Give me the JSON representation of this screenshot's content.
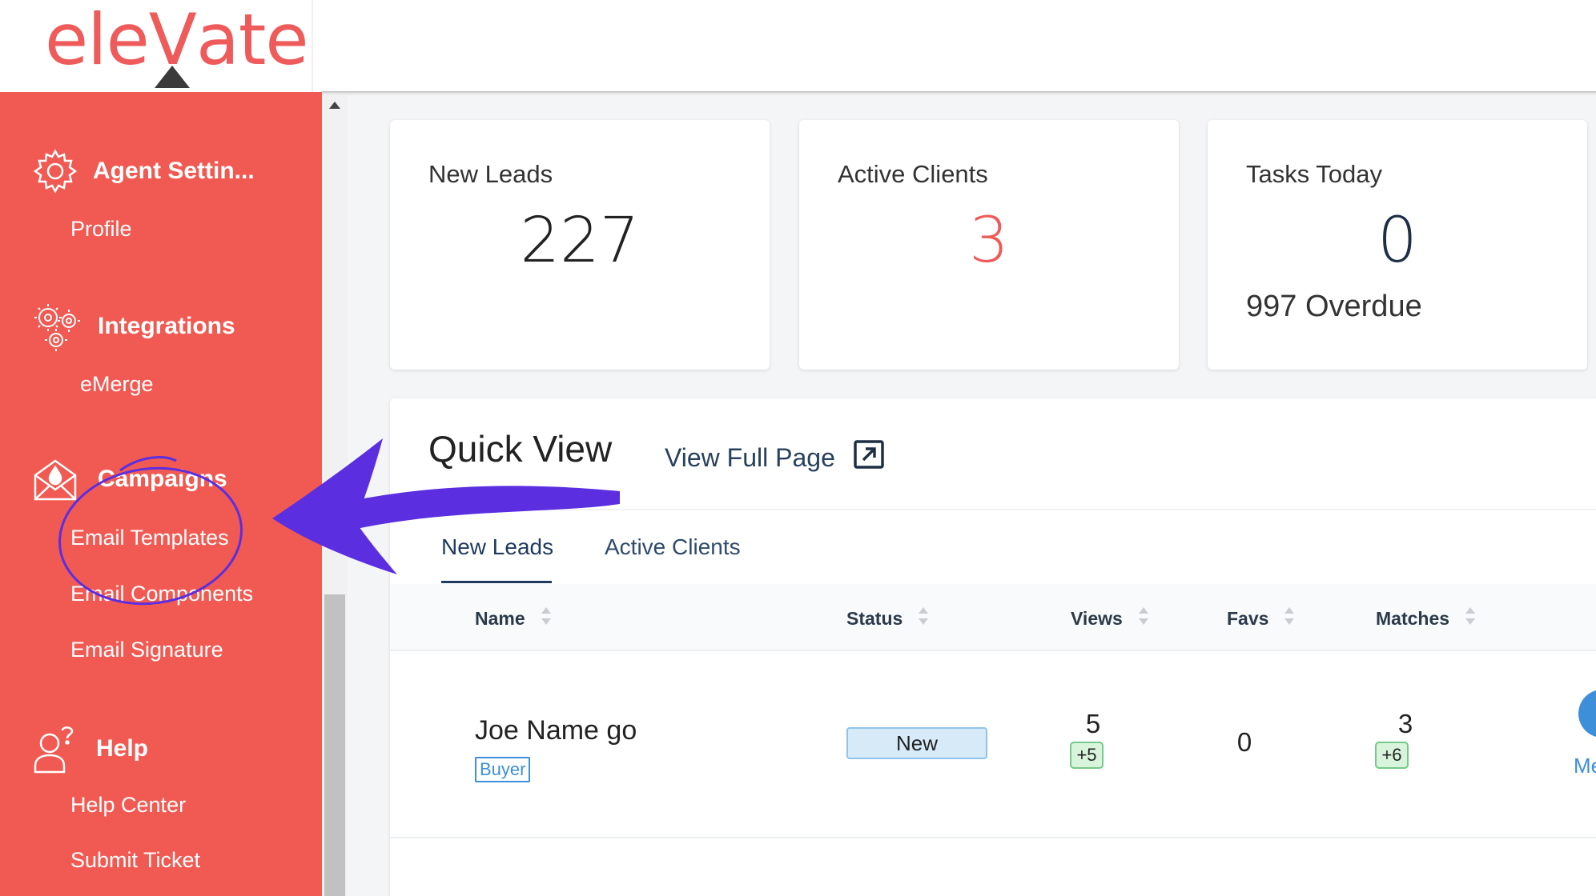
{
  "logo": {
    "text_before": "ele",
    "text_v": "V",
    "text_after": "ate"
  },
  "sidebar": {
    "sections": [
      {
        "icon": "gear-icon",
        "title": "Agent Settin...",
        "links": [
          "Profile"
        ]
      },
      {
        "icon": "gears-icon",
        "title": "Integrations",
        "links": [
          "eMerge"
        ]
      },
      {
        "icon": "envelope-icon",
        "title": "Campaigns",
        "links": [
          "Email Templates",
          "Email Components",
          "Email Signature"
        ]
      },
      {
        "icon": "user-question-icon",
        "title": "Help",
        "links": [
          "Help Center",
          "Submit Ticket"
        ]
      }
    ]
  },
  "stats": {
    "new_leads": {
      "title": "New Leads",
      "value": "227"
    },
    "active_clients": {
      "title": "Active Clients",
      "value": "3"
    },
    "tasks_today": {
      "title": "Tasks Today",
      "value": "0",
      "overdue": "997  Overdue"
    }
  },
  "quick_view": {
    "title": "Quick View",
    "view_full_page": "View Full Page",
    "tabs": [
      "New Leads",
      "Active Clients"
    ],
    "columns": [
      "Name",
      "Status",
      "Views",
      "Favs",
      "Matches"
    ],
    "rows": [
      {
        "name": "Joe Name go",
        "tag": "Buyer",
        "status": "New",
        "views": "5",
        "views_delta": "+5",
        "favs": "0",
        "matches": "3",
        "matches_delta": "+6",
        "action_label": "Me"
      }
    ]
  },
  "colors": {
    "brand": "#f05a52",
    "annotation": "#5b2ee0",
    "link": "#3c8fd8"
  }
}
